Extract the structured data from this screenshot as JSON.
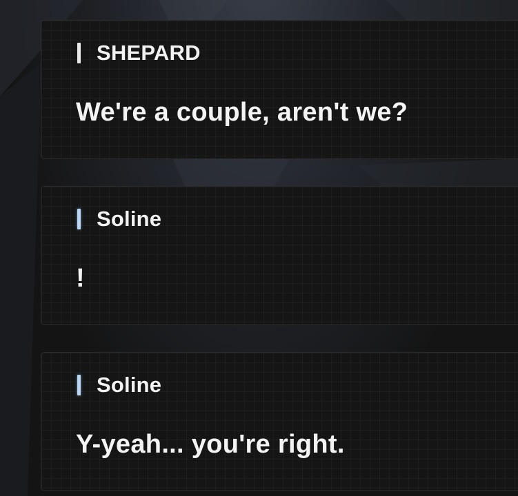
{
  "dialog_log": [
    {
      "speaker": "SHEPARD",
      "marker_color": "#e9e9e9",
      "text": "We're a couple, aren't we?"
    },
    {
      "speaker": "Soline",
      "marker_color": "#b9d7f2",
      "text": "!"
    },
    {
      "speaker": "Soline",
      "marker_color": "#b9d7f2",
      "text": "Y-yeah... you're right."
    }
  ]
}
